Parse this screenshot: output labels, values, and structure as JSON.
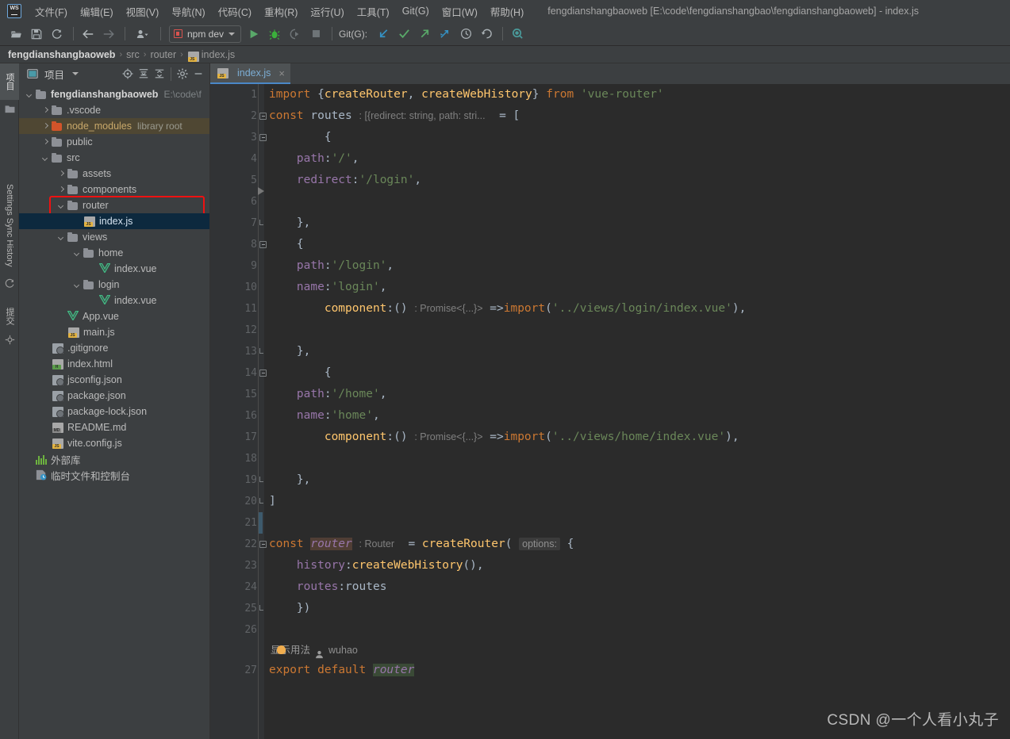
{
  "window": {
    "title": "fengdianshangbaoweb [E:\\code\\fengdianshangbao\\fengdianshangbaoweb] - index.js",
    "logo_text": "WS"
  },
  "menubar": {
    "items": [
      {
        "label": "文件(F)",
        "name": "menu-file"
      },
      {
        "label": "编辑(E)",
        "name": "menu-edit"
      },
      {
        "label": "视图(V)",
        "name": "menu-view"
      },
      {
        "label": "导航(N)",
        "name": "menu-navigate"
      },
      {
        "label": "代码(C)",
        "name": "menu-code"
      },
      {
        "label": "重构(R)",
        "name": "menu-refactor"
      },
      {
        "label": "运行(U)",
        "name": "menu-run"
      },
      {
        "label": "工具(T)",
        "name": "menu-tools"
      },
      {
        "label": "Git(G)",
        "name": "menu-git"
      },
      {
        "label": "窗口(W)",
        "name": "menu-window"
      },
      {
        "label": "帮助(H)",
        "name": "menu-help"
      }
    ]
  },
  "toolbar": {
    "open_icon": "open-folder-icon",
    "save_icon": "save-icon",
    "sync_icon": "refresh-icon",
    "back_icon": "arrow-left-icon",
    "forward_icon": "arrow-right-icon",
    "profile_icon": "user-profile-icon",
    "run_config": "npm dev",
    "run_icon": "run-play-icon",
    "debug_icon": "debug-bug-icon",
    "coverage_icon": "run-coverage-icon",
    "stop_icon": "stop-square-icon",
    "git_label": "Git(G):",
    "update_icon": "git-update-arrow-icon",
    "commit_icon": "git-commit-check-icon",
    "push_icon": "git-push-arrow-icon",
    "branch_icon": "git-branch-icon",
    "history_icon": "git-history-clock-icon",
    "rollback_icon": "git-rollback-icon",
    "search_icon": "search-everywhere-icon"
  },
  "breadcrumb": {
    "segments": [
      "fengdianshangbaoweb",
      "src",
      "router",
      "index.js"
    ],
    "separator": "›",
    "file_icon": "js-file-icon"
  },
  "left_stripe": {
    "project_tab": "项目",
    "settings_sync_tab": "Settings Sync History",
    "commit_tab": "提交"
  },
  "project_panel": {
    "title": "项目",
    "icons": {
      "window_icon": "project-window-icon",
      "dropdown_icon": "chevron-down-icon",
      "locate_icon": "scroll-from-source-icon",
      "expand_icon": "expand-all-icon",
      "collapse_icon": "collapse-all-icon",
      "settings_icon": "gear-icon",
      "hide_icon": "minimize-icon"
    },
    "tree": [
      {
        "label": "fengdianshangbaoweb",
        "suffix": "E:\\code\\f",
        "indent": 0,
        "arrow": "down",
        "icon": "folder",
        "bold": true,
        "name": "tree-node-project-root"
      },
      {
        "label": ".vscode",
        "indent": 1,
        "arrow": "right",
        "icon": "folder",
        "name": "tree-node-vscode"
      },
      {
        "label": "node_modules",
        "suffix": "library root",
        "indent": 1,
        "arrow": "right",
        "icon": "folder-orange",
        "state": "library",
        "name": "tree-node-node-modules"
      },
      {
        "label": "public",
        "indent": 1,
        "arrow": "right",
        "icon": "folder",
        "name": "tree-node-public"
      },
      {
        "label": "src",
        "indent": 1,
        "arrow": "down",
        "icon": "folder",
        "name": "tree-node-src"
      },
      {
        "label": "assets",
        "indent": 2,
        "arrow": "right",
        "icon": "folder",
        "name": "tree-node-assets"
      },
      {
        "label": "components",
        "indent": 2,
        "arrow": "right",
        "icon": "folder",
        "name": "tree-node-components"
      },
      {
        "label": "router",
        "indent": 2,
        "arrow": "down",
        "icon": "folder",
        "name": "tree-node-router"
      },
      {
        "label": "index.js",
        "indent": 3,
        "arrow": "none",
        "icon": "js",
        "state": "selected",
        "name": "tree-node-router-index-js"
      },
      {
        "label": "views",
        "indent": 2,
        "arrow": "down",
        "icon": "folder",
        "name": "tree-node-views"
      },
      {
        "label": "home",
        "indent": 3,
        "arrow": "down",
        "icon": "folder",
        "name": "tree-node-home"
      },
      {
        "label": "index.vue",
        "indent": 4,
        "arrow": "none",
        "icon": "vue",
        "name": "tree-node-home-index-vue"
      },
      {
        "label": "login",
        "indent": 3,
        "arrow": "down",
        "icon": "folder",
        "name": "tree-node-login"
      },
      {
        "label": "index.vue",
        "indent": 4,
        "arrow": "none",
        "icon": "vue",
        "name": "tree-node-login-index-vue"
      },
      {
        "label": "App.vue",
        "indent": 2,
        "arrow": "none",
        "icon": "vue",
        "name": "tree-node-app-vue"
      },
      {
        "label": "main.js",
        "indent": 2,
        "arrow": "none",
        "icon": "js",
        "name": "tree-node-main-js"
      },
      {
        "label": ".gitignore",
        "indent": 1,
        "arrow": "none",
        "icon": "git",
        "name": "tree-node-gitignore"
      },
      {
        "label": "index.html",
        "indent": 1,
        "arrow": "none",
        "icon": "html",
        "name": "tree-node-index-html"
      },
      {
        "label": "jsconfig.json",
        "indent": 1,
        "arrow": "none",
        "icon": "json",
        "name": "tree-node-jsconfig-json"
      },
      {
        "label": "package.json",
        "indent": 1,
        "arrow": "none",
        "icon": "json",
        "name": "tree-node-package-json"
      },
      {
        "label": "package-lock.json",
        "indent": 1,
        "arrow": "none",
        "icon": "json",
        "name": "tree-node-package-lock-json"
      },
      {
        "label": "README.md",
        "indent": 1,
        "arrow": "none",
        "icon": "md",
        "name": "tree-node-readme-md"
      },
      {
        "label": "vite.config.js",
        "indent": 1,
        "arrow": "none",
        "icon": "js",
        "name": "tree-node-vite-config-js"
      },
      {
        "label": "外部库",
        "indent": 0,
        "arrow": "none",
        "icon": "lib",
        "name": "tree-node-external-libraries"
      },
      {
        "label": "临时文件和控制台",
        "indent": 0,
        "arrow": "none",
        "icon": "scratch",
        "name": "tree-node-scratches-consoles"
      }
    ],
    "highlight_color": "#ee1111"
  },
  "editor": {
    "tab": {
      "label": "index.js",
      "icon": "js-file-icon",
      "close": "×"
    },
    "code_lens": {
      "usages_label": "显示用法",
      "author": "wuhao"
    },
    "lines": [
      {
        "n": "1",
        "fold": "none"
      },
      {
        "n": "2",
        "fold": "start"
      },
      {
        "n": "3",
        "fold": "start"
      },
      {
        "n": "4",
        "fold": "none"
      },
      {
        "n": "5",
        "fold": "none"
      },
      {
        "n": "6",
        "fold": "none"
      },
      {
        "n": "7",
        "fold": "end"
      },
      {
        "n": "8",
        "fold": "start"
      },
      {
        "n": "9",
        "fold": "none"
      },
      {
        "n": "10",
        "fold": "none"
      },
      {
        "n": "11",
        "fold": "none"
      },
      {
        "n": "12",
        "fold": "none"
      },
      {
        "n": "13",
        "fold": "end"
      },
      {
        "n": "14",
        "fold": "start"
      },
      {
        "n": "15",
        "fold": "none"
      },
      {
        "n": "16",
        "fold": "none"
      },
      {
        "n": "17",
        "fold": "none"
      },
      {
        "n": "18",
        "fold": "none"
      },
      {
        "n": "19",
        "fold": "end"
      },
      {
        "n": "20",
        "fold": "end"
      },
      {
        "n": "21",
        "fold": "none"
      },
      {
        "n": "22",
        "fold": "start"
      },
      {
        "n": "23",
        "fold": "none"
      },
      {
        "n": "24",
        "fold": "none"
      },
      {
        "n": "25",
        "fold": "end"
      },
      {
        "n": "26",
        "fold": "none"
      },
      {
        "n": "27",
        "fold": "none"
      }
    ],
    "source_text": [
      "import {createRouter, createWebHistory} from 'vue-router'",
      "const routes : [{redirect: string, path: stri...  = [",
      "        {",
      "    path:'/',",
      "    redirect:'/login',",
      "",
      "    },",
      "    {",
      "    path:'/login',",
      "    name:'login',",
      "        component:() : Promise<{...}> =>import('../views/login/index.vue'),",
      "",
      "    },",
      "        {",
      "    path:'/home',",
      "    name:'home',",
      "        component:() : Promise<{...}> =>import('../views/home/index.vue'),",
      "",
      "    },",
      "]",
      "",
      "const router : Router  = createRouter( options: {",
      "    history:createWebHistory(),",
      "    routes:routes",
      "    })",
      "",
      "export default router"
    ]
  },
  "watermark": {
    "text": "CSDN @一个人看小丸子"
  }
}
